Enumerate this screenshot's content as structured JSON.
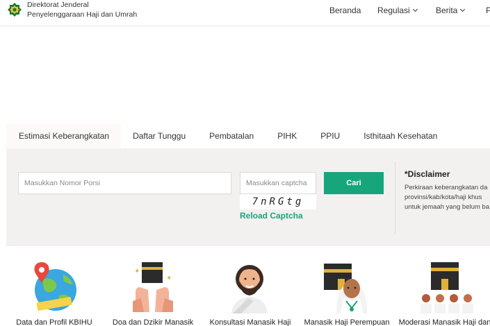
{
  "header": {
    "brand_line1": "Direktorat Jenderal",
    "brand_line2": "Penyelenggaraan Haji dan Umrah",
    "nav": [
      {
        "label": "Beranda"
      },
      {
        "label": "Regulasi"
      },
      {
        "label": "Berita"
      },
      {
        "label": "P"
      }
    ]
  },
  "tabs": [
    {
      "label": "Estimasi Keberangkatan",
      "active": true
    },
    {
      "label": "Daftar Tunggu"
    },
    {
      "label": "Pembatalan"
    },
    {
      "label": "PIHK"
    },
    {
      "label": "PPIU"
    },
    {
      "label": "Isthitaah Kesehatan"
    }
  ],
  "search": {
    "porsi_placeholder": "Masukkan Nomor Porsi",
    "captcha_placeholder": "Masukkan captcha",
    "captcha_text": "7nRGtg",
    "reload_label": "Reload Captcha",
    "submit_label": "Cari"
  },
  "disclaimer": {
    "title": "*Disclaimer",
    "line1": "Perkiraan keberangkatan da",
    "line2": "provinsi/kab/kota/haji khus",
    "line3": "untuk jemaah yang belum ba"
  },
  "services": [
    {
      "label": "Data dan Profil KBIHU",
      "icon": "globe-pin-icon"
    },
    {
      "label": "Doa dan Dzikir Manasik",
      "icon": "praying-hands-kaaba-icon"
    },
    {
      "label": "Konsultasi Manasik Haji",
      "icon": "bearded-man-ihram-icon"
    },
    {
      "label": "Manasik Haji Perempuan",
      "icon": "woman-hijab-kaaba-icon"
    },
    {
      "label": "Moderasi Manasik Haji dan",
      "icon": "pilgrims-kaaba-icon"
    }
  ],
  "colors": {
    "accent": "#17a67c",
    "panel": "#f3f0f0"
  }
}
